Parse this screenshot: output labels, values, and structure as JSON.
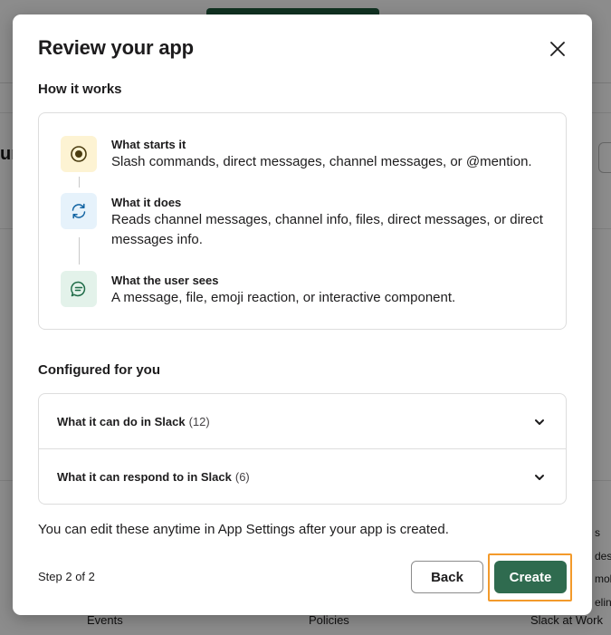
{
  "modal": {
    "title": "Review your app",
    "how_it_works": {
      "heading": "How it works",
      "steps": [
        {
          "icon": "trigger-icon",
          "title": "What starts it",
          "description": "Slash commands, direct messages, channel messages, or @mention."
        },
        {
          "icon": "refresh-icon",
          "title": "What it does",
          "description": "Reads channel messages, channel info, files, direct messages, or direct messages info."
        },
        {
          "icon": "message-icon",
          "title": "What the user sees",
          "description": "A message, file, emoji reaction, or interactive component."
        }
      ]
    },
    "configured": {
      "heading": "Configured for you",
      "items": [
        {
          "label": "What it can do in Slack",
          "count": "(12)"
        },
        {
          "label": "What it can respond to in Slack",
          "count": "(6)"
        }
      ]
    },
    "note": "You can edit these anytime in App Settings after your app is created.",
    "step_indicator": "Step 2 of 2",
    "back_label": "Back",
    "create_label": "Create"
  },
  "background": {
    "edge_heading_fragment": "ur",
    "right_column": [
      "s",
      "desk",
      "mob",
      "elin"
    ],
    "footer_links": [
      "Events",
      "Policies",
      "Slack at Work"
    ]
  },
  "colors": {
    "primary_button": "#2f6b4f",
    "highlight_outline": "#f39a2b",
    "trigger_icon_bg": "#fdf3d3",
    "action_icon_bg": "#e6f2fb",
    "output_icon_bg": "#e3f2ea"
  }
}
